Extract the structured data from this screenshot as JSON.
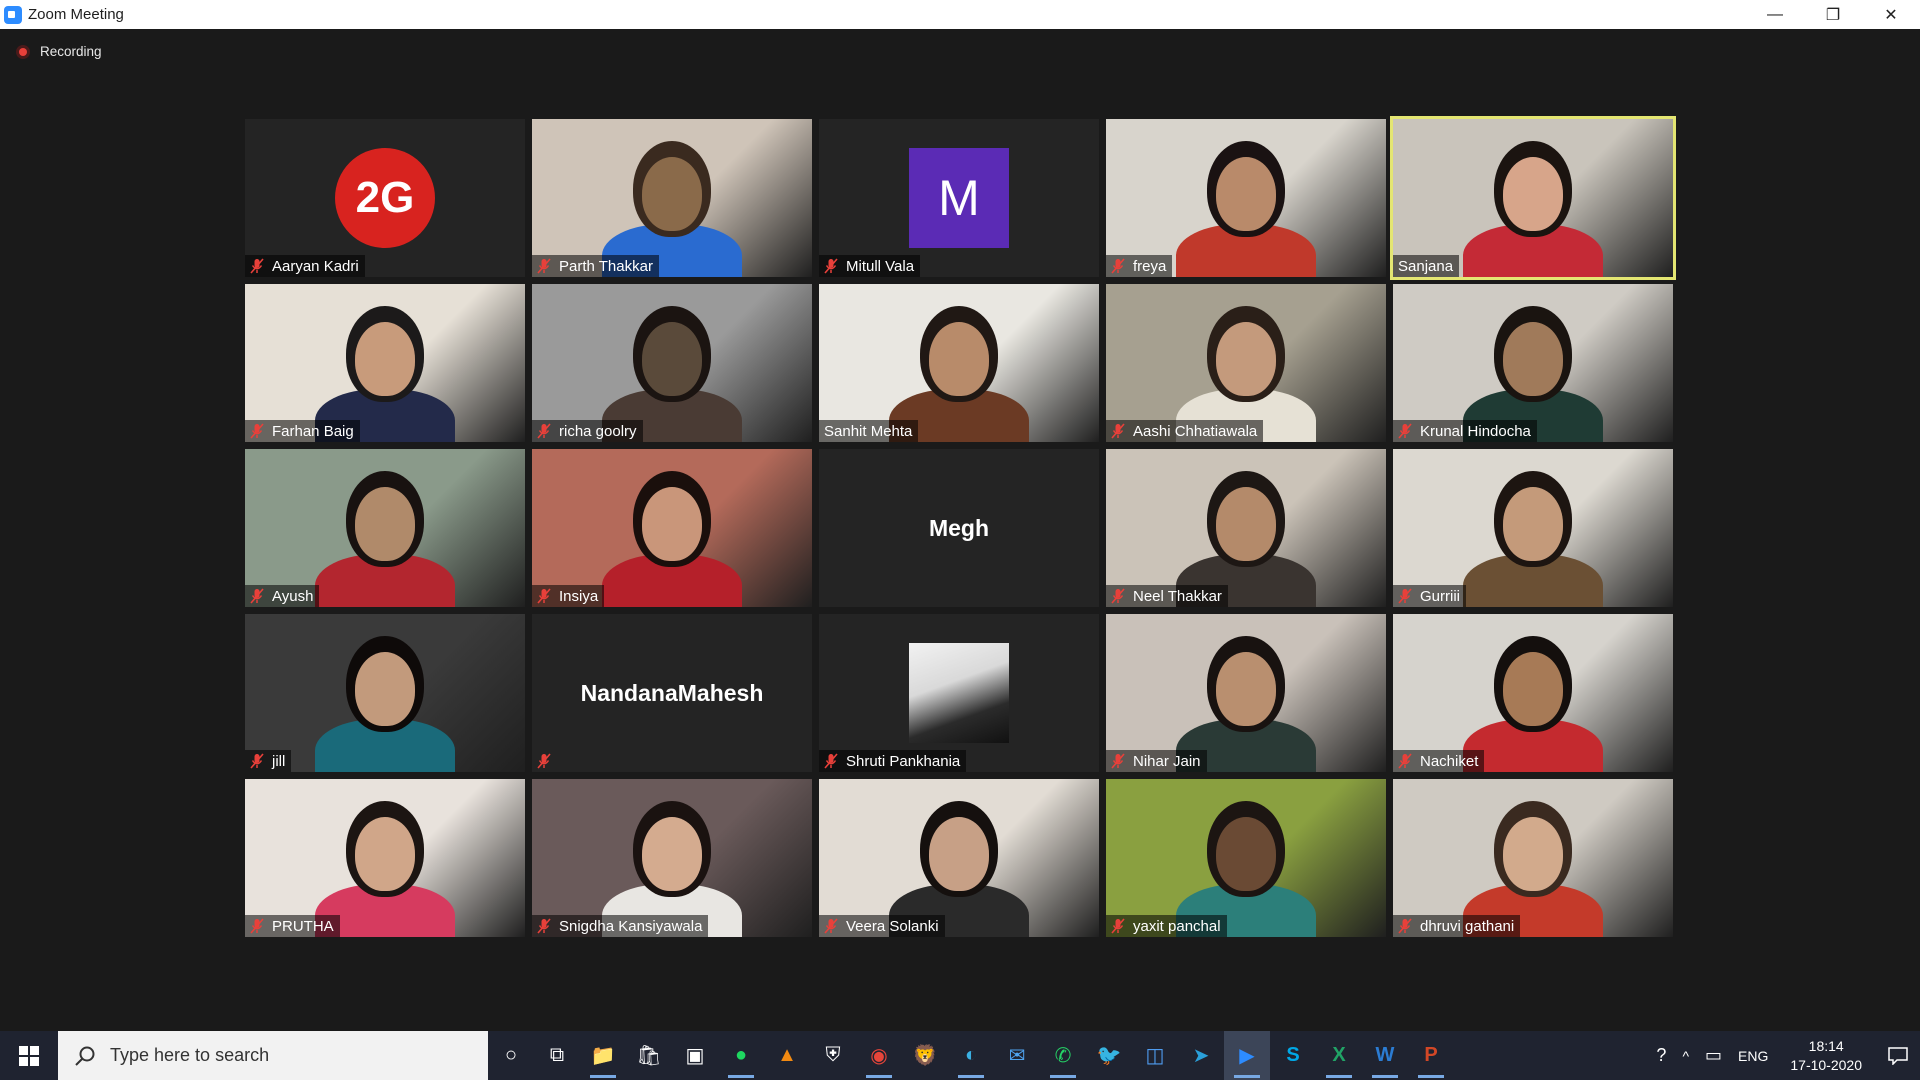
{
  "window": {
    "title": "Zoom Meeting",
    "controls": {
      "minimize": "—",
      "restore": "❐",
      "close": "✕"
    }
  },
  "recording": {
    "label": "Recording"
  },
  "participants": [
    {
      "name": "Aaryan Kadri",
      "muted": true,
      "avatar": "2g-logo",
      "avatar_text": "2G"
    },
    {
      "name": "Parth Thakkar",
      "muted": true,
      "video": true
    },
    {
      "name": "Mitull Vala",
      "muted": true,
      "avatar": "letter",
      "avatar_text": "M"
    },
    {
      "name": "freya",
      "muted": true,
      "video": true
    },
    {
      "name": "Sanjana",
      "muted": false,
      "video": true,
      "active_speaker": true
    },
    {
      "name": "Farhan Baig",
      "muted": true,
      "video": true
    },
    {
      "name": "richa goolry",
      "muted": true,
      "video": true
    },
    {
      "name": "Sanhit Mehta",
      "muted": false,
      "video": true
    },
    {
      "name": "Aashi Chhatiawala",
      "muted": true,
      "video": true
    },
    {
      "name": "Krunal Hindocha",
      "muted": true,
      "video": true
    },
    {
      "name": "Ayush",
      "muted": true,
      "video": true
    },
    {
      "name": "Insiya",
      "muted": true,
      "video": true
    },
    {
      "name": "Megh",
      "muted": false,
      "video": false,
      "centered_name": true
    },
    {
      "name": "Neel Thakkar",
      "muted": true,
      "video": true
    },
    {
      "name": "Gurriii",
      "muted": true,
      "video": true
    },
    {
      "name": "jill",
      "muted": true,
      "video": true
    },
    {
      "name": "NandanaMahesh",
      "muted": true,
      "video": false,
      "centered_name": true
    },
    {
      "name": "Shruti Pankhania",
      "muted": true,
      "avatar": "photo"
    },
    {
      "name": "Nihar Jain",
      "muted": true,
      "video": true
    },
    {
      "name": "Nachiket",
      "muted": true,
      "video": true
    },
    {
      "name": "PRUTHA",
      "muted": true,
      "video": true
    },
    {
      "name": "Snigdha Kansiyawala",
      "muted": true,
      "video": true
    },
    {
      "name": "Veera Solanki",
      "muted": true,
      "video": true
    },
    {
      "name": "yaxit panchal",
      "muted": true,
      "video": true
    },
    {
      "name": "dhruvi gathani",
      "muted": true,
      "video": true
    }
  ],
  "taskbar": {
    "search_placeholder": "Type here to search",
    "apps": [
      {
        "name": "cortana-icon",
        "glyph": "○"
      },
      {
        "name": "task-view-icon",
        "glyph": "⧉"
      },
      {
        "name": "file-explorer-icon",
        "glyph": "📁"
      },
      {
        "name": "store-icon",
        "glyph": "🛍"
      },
      {
        "name": "app-icon",
        "glyph": "▣"
      },
      {
        "name": "spotify-icon",
        "glyph": "●"
      },
      {
        "name": "vlc-icon",
        "glyph": "▲"
      },
      {
        "name": "security-icon",
        "glyph": "⛨"
      },
      {
        "name": "chrome-icon",
        "glyph": "◉"
      },
      {
        "name": "brave-icon",
        "glyph": "🦁"
      },
      {
        "name": "edge-icon",
        "glyph": "◐"
      },
      {
        "name": "mail-icon",
        "glyph": "✉"
      },
      {
        "name": "whatsapp-icon",
        "glyph": "✆"
      },
      {
        "name": "twitter-icon",
        "glyph": "🐦"
      },
      {
        "name": "instagram-icon",
        "glyph": "◫"
      },
      {
        "name": "telegram-icon",
        "glyph": "➤"
      },
      {
        "name": "zoom-icon",
        "glyph": "▶"
      },
      {
        "name": "skype-icon",
        "glyph": "S"
      },
      {
        "name": "excel-icon",
        "glyph": "X"
      },
      {
        "name": "word-icon",
        "glyph": "W"
      },
      {
        "name": "powerpoint-icon",
        "glyph": "P"
      }
    ],
    "tray": {
      "help": "?",
      "chevron": "^",
      "battery": "▭",
      "language": "ENG",
      "time": "18:14",
      "date": "17-10-2020"
    }
  },
  "colors": {
    "active_speaker_border": "#e4e672",
    "muted_icon": "#e8403a",
    "background": "#1a1a1a",
    "tile": "#242424",
    "taskbar": "#1f2330"
  }
}
